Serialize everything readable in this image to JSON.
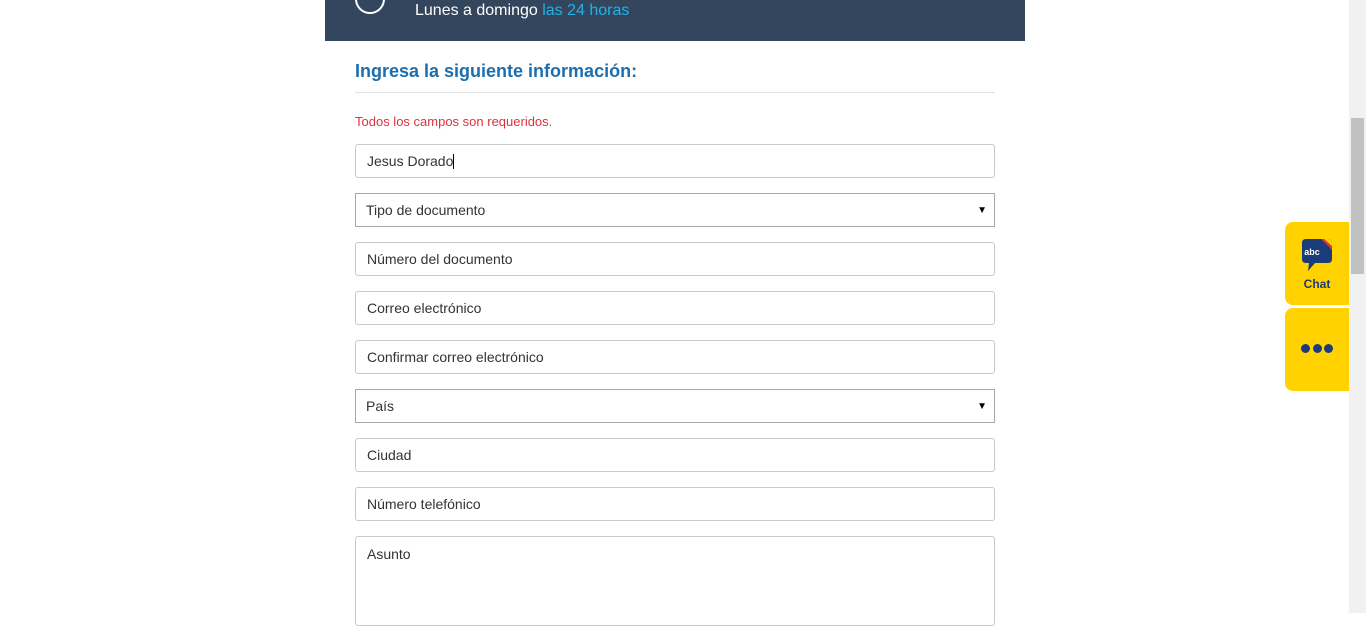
{
  "banner": {
    "text_main": "Lunes a domingo",
    "text_highlight": "las 24 horas",
    "icon": "clock-icon"
  },
  "form": {
    "title": "Ingresa la siguiente información:",
    "required_note": "Todos los campos son requeridos.",
    "name_value": "Jesus Dorado",
    "document_type_selected": "Tipo de documento",
    "document_number_placeholder": "Número del documento",
    "email_placeholder": "Correo electrónico",
    "confirm_email_placeholder": "Confirmar correo electrónico",
    "country_selected": "País",
    "city_placeholder": "Ciudad",
    "phone_placeholder": "Número telefónico",
    "subject_placeholder": "Asunto"
  },
  "side_widgets": {
    "chat_label": "Chat",
    "chat_icon_text": "abc",
    "more_icon": "more-dots-icon"
  },
  "colors": {
    "banner_bg": "#34465e",
    "highlight": "#1fb3e8",
    "title": "#1c6eae",
    "error": "#e0313e",
    "widget_bg": "#ffd200",
    "widget_fg": "#1c3b7a"
  }
}
